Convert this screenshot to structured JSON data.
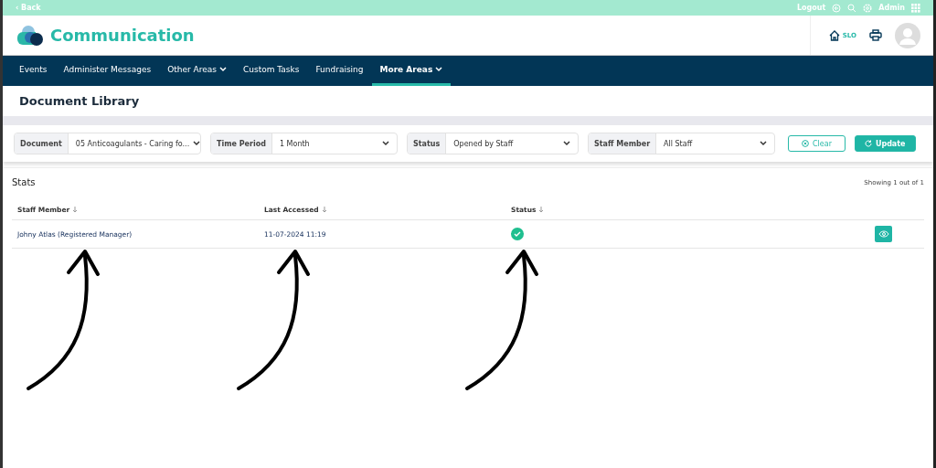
{
  "top_bar": {
    "back": "‹ Back",
    "logout": "Logout",
    "user": "Admin"
  },
  "header": {
    "app_title": "Communication",
    "home_label": "SLO"
  },
  "nav": [
    {
      "label": "Events",
      "selected": false,
      "dropdown": false
    },
    {
      "label": "Administer Messages",
      "selected": false,
      "dropdown": false
    },
    {
      "label": "Other Areas",
      "selected": false,
      "dropdown": true
    },
    {
      "label": "Custom Tasks",
      "selected": false,
      "dropdown": false
    },
    {
      "label": "Fundraising",
      "selected": false,
      "dropdown": false
    },
    {
      "label": "More Areas",
      "selected": true,
      "dropdown": true
    }
  ],
  "page_title": "Document Library",
  "filters": [
    {
      "label": "Document",
      "value": "05 Anticoagulants - Caring fo..."
    },
    {
      "label": "Time Period",
      "value": "1 Month"
    },
    {
      "label": "Status",
      "value": "Opened by Staff"
    },
    {
      "label": "Staff Member",
      "value": "All Staff"
    }
  ],
  "buttons": {
    "clear": "Clear",
    "update": "Update"
  },
  "stats": {
    "title": "Stats",
    "showing": "Showing 1 out of 1",
    "columns": [
      "Staff Member",
      "Last Accessed",
      "Status"
    ],
    "rows": [
      {
        "staff_member": "Johny Atlas (Registered Manager)",
        "last_accessed": "11-07-2024 11:19",
        "opened": true
      }
    ]
  },
  "annotations": [
    {
      "kind": "arrow"
    },
    {
      "kind": "arrow"
    },
    {
      "kind": "arrow"
    }
  ]
}
